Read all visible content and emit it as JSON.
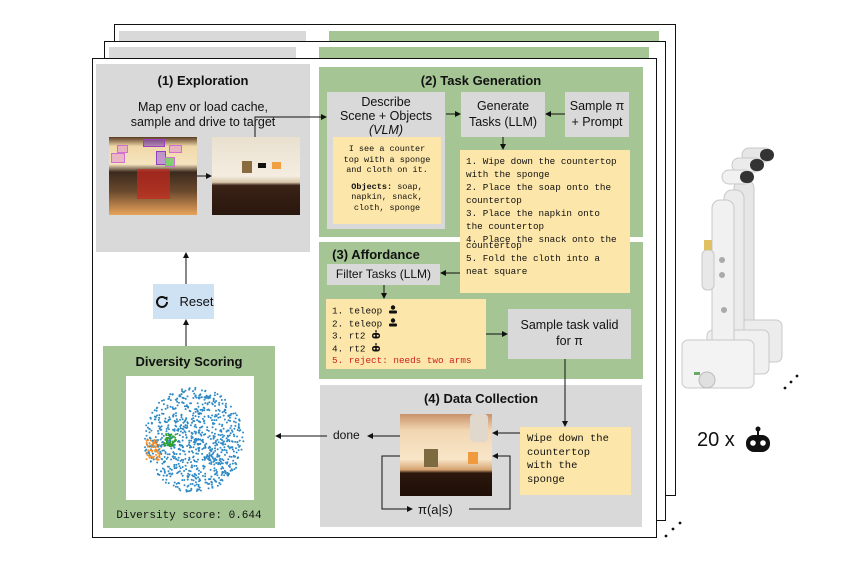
{
  "colors": {
    "panel_gray": "#d9d9d9",
    "panel_green": "#a5c594",
    "note_yellow": "#fce6a9",
    "reset_blue": "#cfe2f3",
    "reject_red": "#cc2222",
    "scatter_blue": "#2f8ac4",
    "scatter_orange": "#f28e2b",
    "scatter_green": "#2ca02c"
  },
  "exploration": {
    "title": "(1) Exploration",
    "description_line1": "Map env or load cache,",
    "description_line2": "sample and drive to target"
  },
  "task_generation": {
    "title": "(2) Task Generation",
    "describe_line1": "Describe",
    "describe_line2": "Scene + Objects",
    "describe_line3": "(VLM)",
    "generate_line1": "Generate",
    "generate_line2": "Tasks (LLM)",
    "sample_line1": "Sample π",
    "sample_line2": "+ Prompt",
    "scene_description": [
      "I see a counter",
      "top with a sponge",
      "and cloth on it."
    ],
    "objects_label": "Objects:",
    "objects_line1": " soap,",
    "objects_rest": [
      "napkin, snack,",
      "cloth, sponge"
    ],
    "tasks": [
      "1. Wipe down the countertop",
      "with the sponge",
      "2. Place the soap onto the",
      "countertop",
      "3. Place the napkin onto",
      "the countertop",
      "4. Place the snack onto the",
      "countertop",
      "5. Fold the cloth into a",
      "neat square"
    ]
  },
  "affordance": {
    "title": "(3) Affordance",
    "filter_label": "Filter Tasks (LLM)",
    "results": [
      {
        "text": "1. teleop",
        "icon": "person-icon"
      },
      {
        "text": "2. teleop",
        "icon": "person-icon"
      },
      {
        "text": "3. rt2",
        "icon": "robot-icon"
      },
      {
        "text": "4. rt2",
        "icon": "robot-icon"
      },
      {
        "text": "5. reject: needs two arms",
        "icon": ""
      }
    ],
    "sample_valid_line1": "Sample task valid",
    "sample_valid_line2": "for π"
  },
  "data_collection": {
    "title": "(4) Data Collection",
    "instruction": [
      "Wipe down the",
      "countertop",
      "with the",
      "sponge"
    ],
    "policy_label": "π(a|s)",
    "done_label": "done"
  },
  "reset": {
    "label": "Reset"
  },
  "diversity": {
    "title": "Diversity Scoring",
    "score_text": "Diversity score: 0.644"
  },
  "fleet": {
    "count_label": "20 x"
  }
}
